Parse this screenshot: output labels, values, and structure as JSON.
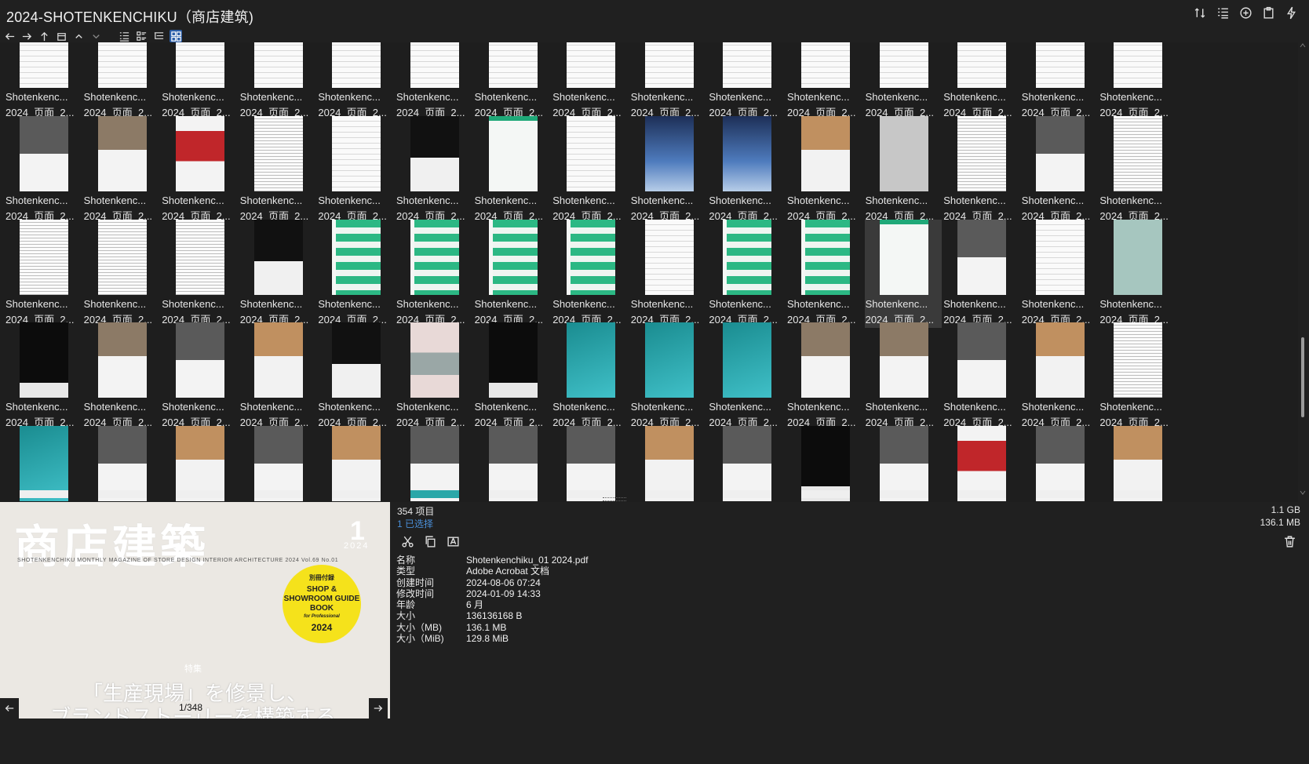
{
  "window": {
    "title": "2024-SHOTENKENCHIKU（商店建筑)",
    "title_icons": [
      "sort-icon",
      "list-details-icon",
      "add-circle-icon",
      "clipboard-icon",
      "bolt-icon"
    ]
  },
  "toolbar": {
    "nav_icons": [
      "back-arrow-icon",
      "forward-arrow-icon",
      "up-arrow-icon",
      "window-icon",
      "chevron-up-icon",
      "chevron-down-icon"
    ],
    "view_icons": [
      "list-view-icon",
      "detail-view-icon",
      "tree-view-icon",
      "grid-view-icon"
    ],
    "active_view": "grid-view-icon"
  },
  "grid": {
    "caption_line1": "Shotenkenc...",
    "caption_line2": "2024_页面_2...",
    "selected_index": 41,
    "items": [
      "t-white",
      "t-white",
      "t-white",
      "t-white",
      "t-white",
      "t-white",
      "t-white",
      "t-white",
      "t-white",
      "t-white",
      "t-white",
      "t-white",
      "t-white",
      "t-white",
      "t-white",
      "t-photo2",
      "t-photo",
      "t-red",
      "t-text",
      "t-white",
      "t-dark",
      "t-green",
      "t-white",
      "t-sky",
      "t-sky",
      "t-orange",
      "t-grey",
      "t-text",
      "t-photo2",
      "t-text",
      "t-text",
      "t-text",
      "t-text",
      "t-dark",
      "t-green-grid",
      "t-green-grid",
      "t-green-grid",
      "t-green-grid",
      "t-white",
      "t-green-grid",
      "t-green-grid",
      "t-green",
      "t-photo2",
      "t-white",
      "t-sage",
      "t-black",
      "t-photo",
      "t-photo2",
      "t-orange",
      "t-dark",
      "t-pink",
      "t-black",
      "t-teal",
      "t-teal",
      "t-teal",
      "t-photo",
      "t-photo",
      "t-photo2",
      "t-orange",
      "t-text",
      "t-teal",
      "t-photo2",
      "t-orange",
      "t-photo2",
      "t-orange",
      "t-photo2",
      "t-photo2",
      "t-photo2",
      "t-orange",
      "t-photo2",
      "t-black",
      "t-photo2",
      "t-red",
      "t-photo2",
      "t-orange"
    ]
  },
  "preview": {
    "magazine_title": "商店建築",
    "issue_number": "1",
    "issue_year": "2024",
    "subtitle": "SHOTENKENCHIKU  MONTHLY MAGAZINE OF STORE DESIGN INTERIOR ARCHITECTURE  2024 Vol.69 No.01",
    "badge_top": "別冊付録",
    "badge_main": "SHOP & SHOWROOM GUIDE BOOK",
    "badge_sub": "for Professional",
    "badge_year": "2024",
    "feature_label": "特集",
    "headline_1": "「生産現場」を修景し、",
    "headline_2": "ブランドストーリーを構築する",
    "page_indicator": "1/348"
  },
  "info": {
    "item_count": "354 项目",
    "selected_count": "1 已选择",
    "total_size": "1.1 GB",
    "selected_size": "136.1 MB",
    "properties": [
      {
        "key": "名称",
        "value": "Shotenkenchiku_01 2024.pdf"
      },
      {
        "key": "类型",
        "value": "Adobe Acrobat 文档"
      },
      {
        "key": "创建时间",
        "value": "2024-08-06  07:24"
      },
      {
        "key": "修改时间",
        "value": "2024-01-09  14:33"
      },
      {
        "key": "年龄",
        "value": "6 月"
      },
      {
        "key": "大小",
        "value": "136136168 B"
      },
      {
        "key": "大小（MB)",
        "value": "136.1 MB"
      },
      {
        "key": "大小（MiB)",
        "value": "129.8 MiB"
      }
    ]
  },
  "colors": {
    "background": "#202020",
    "accent": "#2d5fa8",
    "link": "#4a8fd8",
    "badge": "#f5e21b"
  }
}
